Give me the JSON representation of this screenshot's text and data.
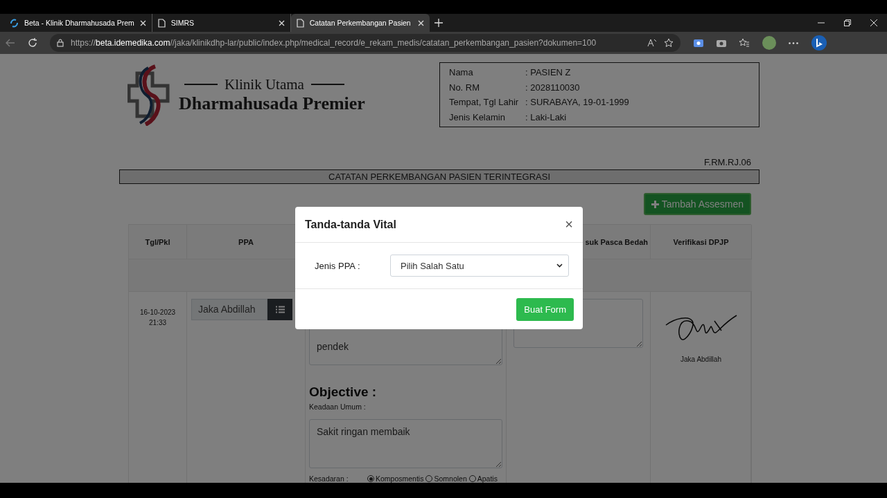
{
  "browser": {
    "tabs": [
      {
        "title": "Beta - Klinik Dharmahusada Prem",
        "kind": "brand",
        "selected": false
      },
      {
        "title": "SIMRS",
        "kind": "page",
        "selected": false
      },
      {
        "title": "Catatan Perkembangan Pasien",
        "kind": "page",
        "selected": true
      }
    ],
    "url": "https://**beta.idemedika.com**//jaka/klinikdhp-lar/public/index.php/medical_record/e_rekam_medis/catatan_perkembangan_pasien?dokumen=100"
  },
  "header": {
    "clinic_line": "Klinik Utama",
    "clinic_name": "Dharmahusada Premier",
    "patient": [
      {
        "label": "Nama",
        "value": ": PASIEN Z"
      },
      {
        "label": "No. RM",
        "value": ": 2028110030"
      },
      {
        "label": "Tempat, Tgl Lahir",
        "value": ": SURABAYA, 19-01-1999"
      },
      {
        "label": "Jenis Kelamin",
        "value": ": Laki-Laki"
      }
    ]
  },
  "form_code": "F.RM.RJ.06",
  "form_title": "CATATAN PERKEMBANGAN PASIEN TERINTEGRASI",
  "add_button": "Tambah Assesmen",
  "table": {
    "columns": [
      {
        "label": "Tgl/Pkl"
      },
      {
        "label": "PPA"
      },
      {
        "label": "suk Pasca Bedah"
      },
      {
        "label": "Verifikasi DPJP"
      }
    ],
    "row": {
      "date": "16-10-2023",
      "time": "21:33",
      "ppa": "Jaka Abdillah",
      "subjective_tail": "pendek",
      "objective_heading": "Objective :",
      "keadaan_label": "Keadaan Umum :",
      "keadaan_value": "Sakit ringan membaik",
      "kesadaran_label": "Kesadaran :",
      "kesadaran_options": [
        {
          "label": "Komposmentis",
          "selected": true
        },
        {
          "label": "Somnolen",
          "selected": false
        },
        {
          "label": "Apatis",
          "selected": false
        }
      ],
      "verifier": "Jaka Abdillah"
    }
  },
  "modal": {
    "title": "Tanda-tanda Vital",
    "close": "×",
    "field_label": "Jenis PPA :",
    "select_value": "Pilih Salah Satu",
    "submit": "Buat Form"
  }
}
